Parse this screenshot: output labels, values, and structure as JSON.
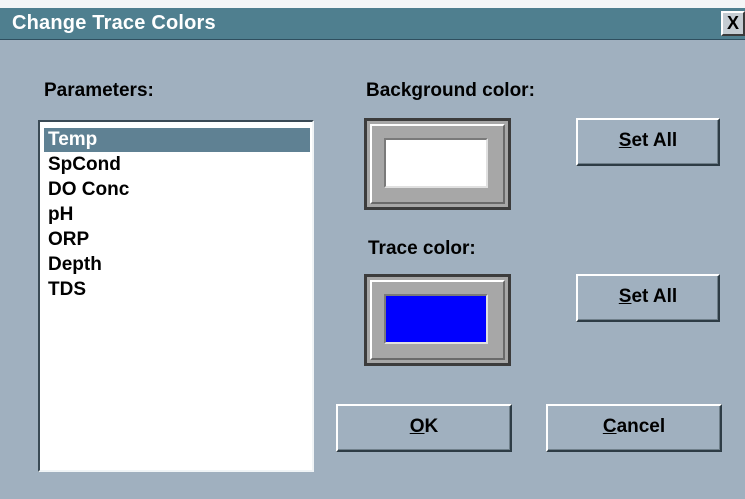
{
  "window": {
    "title": "Change Trace Colors",
    "close_label": "X"
  },
  "parameters": {
    "label": "Parameters:",
    "items": [
      "Temp",
      "SpCond",
      "DO Conc",
      "pH",
      "ORP",
      "Depth",
      "TDS"
    ],
    "selected": "Temp"
  },
  "background": {
    "label": "Background color:",
    "color": "#ffffff",
    "set_all_mnemonic": "S",
    "set_all_rest": "et All"
  },
  "trace": {
    "label": "Trace color:",
    "color": "#0000ff",
    "set_all_mnemonic": "S",
    "set_all_rest": "et All"
  },
  "buttons": {
    "ok_mnemonic": "O",
    "ok_rest": "K",
    "cancel_mnemonic": "C",
    "cancel_rest": "ancel"
  }
}
